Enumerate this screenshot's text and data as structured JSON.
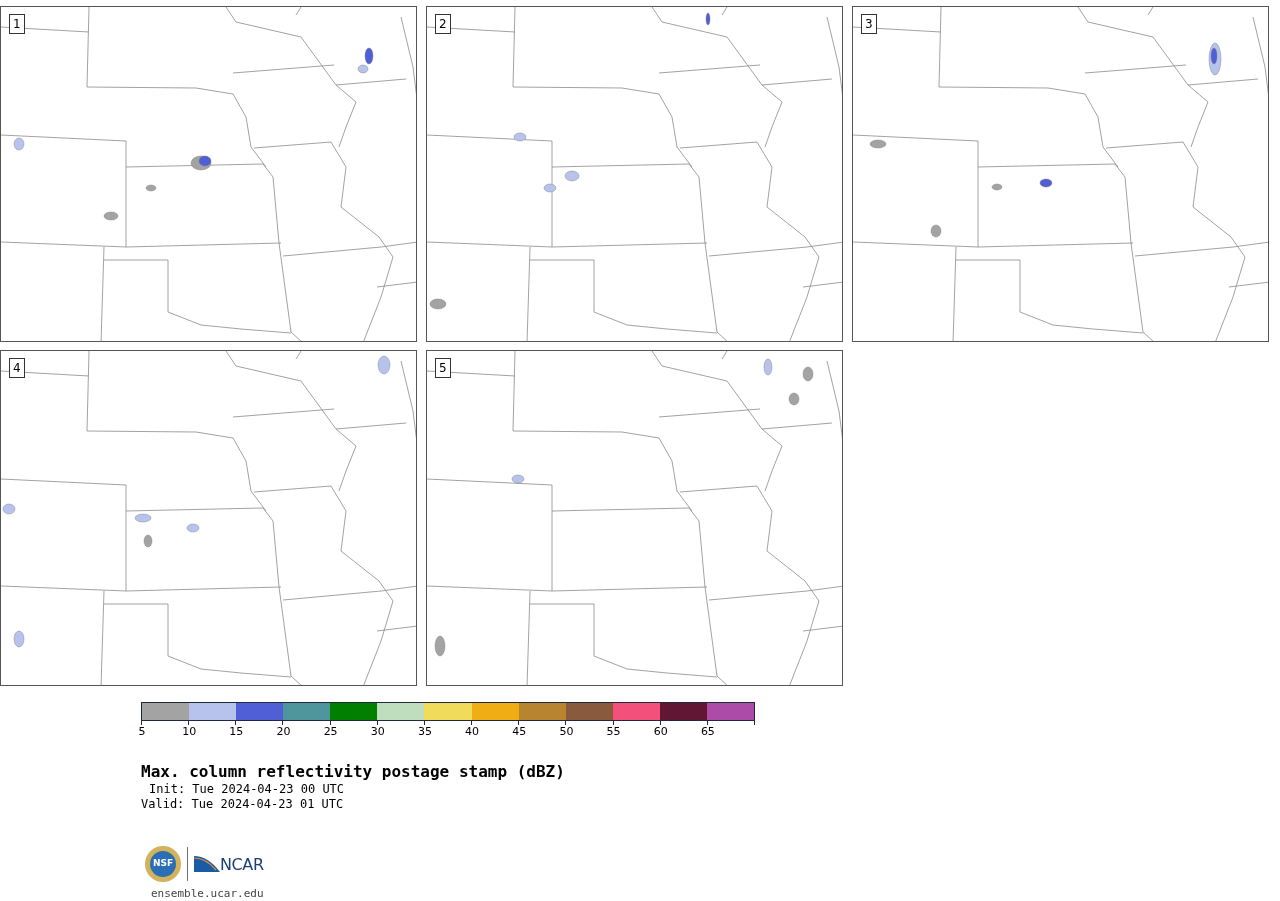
{
  "panels": [
    {
      "label": "1"
    },
    {
      "label": "2"
    },
    {
      "label": "3"
    },
    {
      "label": "4"
    },
    {
      "label": "5"
    }
  ],
  "colorbar": [
    {
      "label": "5",
      "color": "#a3a3a3"
    },
    {
      "label": "10",
      "color": "#b7c3ec"
    },
    {
      "label": "15",
      "color": "#515fd6"
    },
    {
      "label": "20",
      "color": "#4e969b"
    },
    {
      "label": "25",
      "color": "#007f00"
    },
    {
      "label": "30",
      "color": "#bfdebd"
    },
    {
      "label": "35",
      "color": "#f0db5a"
    },
    {
      "label": "40",
      "color": "#f0ad14"
    },
    {
      "label": "45",
      "color": "#b98430"
    },
    {
      "label": "50",
      "color": "#8a5a3e"
    },
    {
      "label": "55",
      "color": "#f4507c"
    },
    {
      "label": "60",
      "color": "#611734"
    },
    {
      "label": "65",
      "color": "#ad4ca8"
    }
  ],
  "title": "Max. column reflectivity postage stamp (dBZ)",
  "init": "Init: Tue 2024-04-23 00 UTC",
  "valid": "Valid: Tue 2024-04-23 01 UTC",
  "logo": {
    "left": "NSF",
    "right": "NCAR"
  },
  "url": "ensemble.ucar.edu"
}
